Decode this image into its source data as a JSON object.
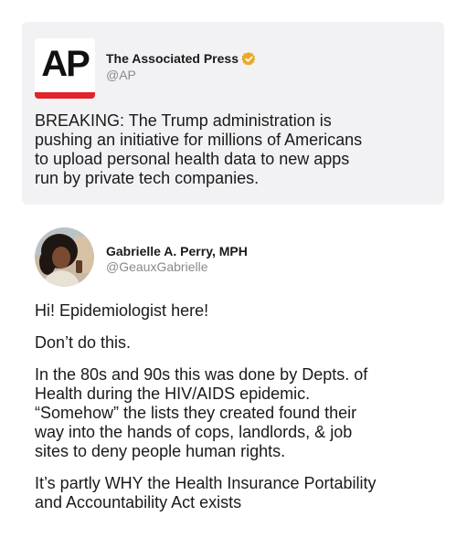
{
  "colors": {
    "card_background": "#f2f2f4",
    "ap_red": "#e0232b",
    "verified_gold": "#e8a92b",
    "handle_gray": "#8a8a8a",
    "text": "#1a1a1a"
  },
  "quoted_tweet": {
    "logo_text": "AP",
    "author_name": "The Associated Press",
    "verified_icon": "verified-badge-icon",
    "handle": "@AP",
    "text": "BREAKING: The Trump administration is\npushing an initiative for millions of Americans\nto upload personal health data to new apps\nrun by private tech companies."
  },
  "reply_tweet": {
    "author_name": "Gabrielle A. Perry, MPH",
    "handle": "@GeauxGabrielle",
    "paragraphs": [
      "Hi! Epidemiologist here!",
      "Don’t do this.",
      "In the 80s and 90s this was done by Depts. of\nHealth during the HIV/AIDS epidemic.\n“Somehow” the lists they created found their\nway into the hands of cops, landlords, & job\nsites to deny people human rights.",
      "It’s partly WHY the Health Insurance Portability\nand Accountability Act exists"
    ]
  }
}
